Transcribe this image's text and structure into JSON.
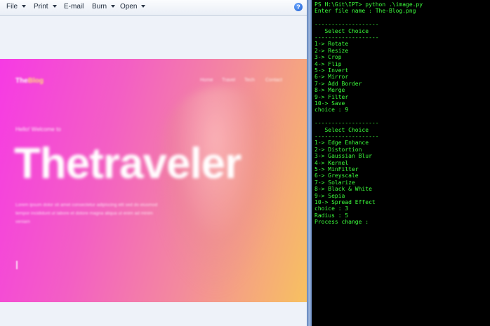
{
  "menu": {
    "items": [
      {
        "label": "File",
        "has_arrow": true
      },
      {
        "label": "Print",
        "has_arrow": true
      },
      {
        "label": "E-mail",
        "has_arrow": false
      },
      {
        "label": "Burn",
        "has_arrow": true
      },
      {
        "label": "Open",
        "has_arrow": true
      }
    ],
    "help_icon": "help-icon",
    "help_glyph": "?"
  },
  "image": {
    "logo_main": "The",
    "logo_accent": "Blog",
    "nav": [
      "Home",
      "Travel",
      "Tech",
      "Contact"
    ],
    "welcome": "Hello! Welcome to",
    "hero_title": "Thetraveler",
    "paragraph": "Lorem ipsum dolor sit amet consectetur adipiscing elit sed do eiusmod tempor incididunt ut labore et dolore magna aliqua ut enim ad minim veniam",
    "colors": {
      "left": "#f63ae4",
      "right": "#f7c160"
    }
  },
  "terminal": {
    "lines": [
      "PS H:\\Git\\IPT> python .\\image.py",
      "Enter file name : The-Blog.png",
      "",
      "-------------------",
      "   Select Choice",
      "-------------------",
      "1-> Rotate",
      "2-> Resize",
      "3-> Crop",
      "4-> Flip",
      "5-> Invert",
      "6-> Mirror",
      "7-> Add Border",
      "8-> Merge",
      "9-> Filter",
      "10-> Save",
      "choice : 9",
      "",
      "-------------------",
      "   Select Choice",
      "-------------------",
      "1-> Edge Enhance",
      "2-> Distortion",
      "3-> Gaussian Blur",
      "4-> Kernel",
      "5-> MinFilter",
      "6-> Greyscale",
      "7-> Solarize",
      "8-> Black & White",
      "9-> Sepia",
      "10-> Spread Effect",
      "choice : 3",
      "Radius : 5",
      "Process change :"
    ],
    "text_color": "#3cff3c",
    "background": "#000000"
  }
}
